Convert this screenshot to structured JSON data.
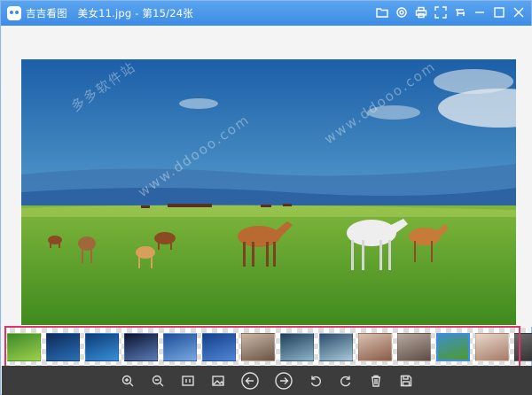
{
  "window": {
    "app_name": "吉吉看图",
    "file_title": "美女11.jpg - 第15/24张",
    "title_icons": [
      "folder-icon",
      "settings-icon",
      "print-icon",
      "fullscreen-icon",
      "pin-icon",
      "minimize-icon",
      "maximize-icon",
      "close-icon"
    ]
  },
  "viewer": {
    "watermarks": [
      "多多软件站",
      "www.ddooo.com"
    ]
  },
  "filmstrip": {
    "thumbnails": [
      {
        "name": "thumb-green-leaf",
        "colors": [
          "#3c8a2a",
          "#9ed04a"
        ]
      },
      {
        "name": "thumb-blue-apple",
        "colors": [
          "#0d2a5a",
          "#2a6fb5"
        ]
      },
      {
        "name": "thumb-blue-apple-2",
        "colors": [
          "#0a3c78",
          "#3a8fd8"
        ]
      },
      {
        "name": "thumb-galaxy",
        "colors": [
          "#0b1430",
          "#5a7cb8"
        ]
      },
      {
        "name": "thumb-blue-sky",
        "colors": [
          "#1d4f9a",
          "#79a8e0"
        ]
      },
      {
        "name": "thumb-blue-abstract",
        "colors": [
          "#15408a",
          "#4f86d6"
        ]
      },
      {
        "name": "thumb-group-photo",
        "colors": [
          "#c9b7a6",
          "#6b5445"
        ]
      },
      {
        "name": "thumb-lake",
        "colors": [
          "#1f3f5a",
          "#8db4c9"
        ]
      },
      {
        "name": "thumb-mountain-lake",
        "colors": [
          "#2b4e6b",
          "#a9c7d8"
        ]
      },
      {
        "name": "thumb-portrait-1",
        "colors": [
          "#d9c2b0",
          "#8a5a48"
        ]
      },
      {
        "name": "thumb-portrait-2",
        "colors": [
          "#b6a9a0",
          "#5e4c44"
        ]
      },
      {
        "name": "thumb-horses-current",
        "colors": [
          "#3e8fc7",
          "#4f9a2e"
        ]
      },
      {
        "name": "thumb-portrait-3",
        "colors": [
          "#e8d8cc",
          "#a67a66"
        ]
      },
      {
        "name": "thumb-dark",
        "colors": [
          "#6b6b6b",
          "#2b2b2b"
        ]
      }
    ],
    "active_index": 11
  },
  "toolbar": {
    "buttons": [
      "zoom-in-icon",
      "zoom-out-icon",
      "actual-size-icon",
      "image-icon",
      "previous-icon",
      "next-icon",
      "rotate-left-icon",
      "rotate-right-icon",
      "delete-icon",
      "save-icon"
    ]
  }
}
